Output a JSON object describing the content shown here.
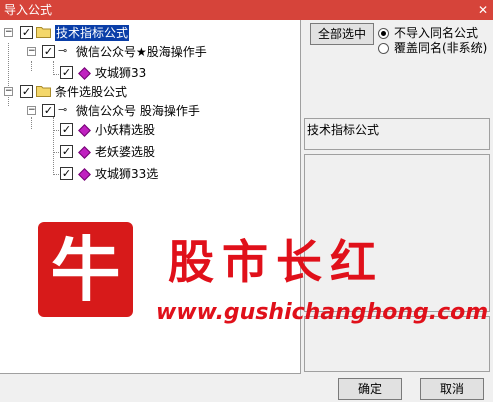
{
  "window": {
    "title": "导入公式",
    "close_glyph": "✕"
  },
  "tree": {
    "items": [
      {
        "label": "技术指标公式",
        "type": "category",
        "checked": true,
        "selected": true
      },
      {
        "label": "微信公众号★股海操作手",
        "type": "group",
        "checked": true
      },
      {
        "label": "攻城狮33",
        "type": "formula",
        "checked": true
      },
      {
        "label": "条件选股公式",
        "type": "category",
        "checked": true
      },
      {
        "label": "微信公众号 股海操作手",
        "type": "group",
        "checked": true
      },
      {
        "label": "小妖精选股",
        "type": "formula",
        "checked": true
      },
      {
        "label": "老妖婆选股",
        "type": "formula",
        "checked": true
      },
      {
        "label": "攻城狮33选",
        "type": "formula",
        "checked": true
      }
    ],
    "expander_minus": "−",
    "check_glyph": "✓"
  },
  "options": {
    "select_all_label": "全部选中",
    "radio": [
      {
        "label": "不导入同名公式",
        "checked": true
      },
      {
        "label": "覆盖同名(非系统)",
        "checked": false
      }
    ]
  },
  "info": {
    "category_label": "技术指标公式"
  },
  "footer": {
    "ok_label": "确定",
    "cancel_label": "取消"
  },
  "watermark": {
    "seal_char": "牛",
    "brand": "股市长红",
    "url": "www.gushichanghong.com"
  },
  "colors": {
    "titlebar": "#d6443a",
    "selection": "#0a3ea8",
    "watermark": "#e0101a"
  },
  "icons": {
    "folder": "folder-icon",
    "link": "link-icon",
    "formula": "formula-gem-icon"
  }
}
